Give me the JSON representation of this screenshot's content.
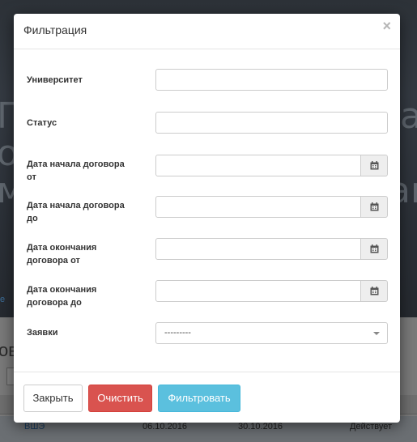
{
  "background": {
    "hero_lines": [
      "Пе",
      "ор",
      "ма"
    ],
    "hero_right": [
      "а",
      "ан"
    ],
    "link_text": "е",
    "section_heading": "ове",
    "table_row": {
      "col1": "ВШЭ",
      "col2": "06.10.2016",
      "col3": "30.10.2016",
      "col4": "Действует"
    }
  },
  "modal": {
    "title": "Фильтрация",
    "close_symbol": "×",
    "fields": {
      "university": {
        "label": "Университет",
        "value": ""
      },
      "status": {
        "label": "Статус",
        "value": ""
      },
      "contract_start_from": {
        "label": "Дата начала договора от",
        "value": ""
      },
      "contract_start_to": {
        "label": "Дата начала договора до",
        "value": ""
      },
      "contract_end_from": {
        "label": "Дата окончания договора от",
        "value": ""
      },
      "contract_end_to": {
        "label": "Дата окончания договора до",
        "value": ""
      },
      "requests": {
        "label": "Заявки",
        "selected": "---------"
      }
    },
    "buttons": {
      "close": "Закрыть",
      "clear": "Очистить",
      "filter": "Фильтровать"
    }
  },
  "colors": {
    "clear_button": "#d9534f",
    "filter_button": "#5bc0de"
  }
}
